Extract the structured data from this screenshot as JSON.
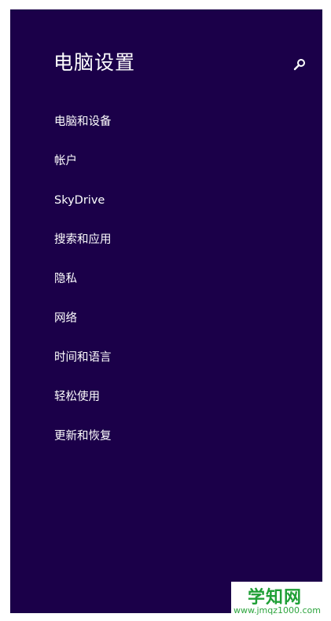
{
  "window": {
    "title": "电脑设置"
  },
  "icons": {
    "search": "search-icon"
  },
  "menu": {
    "items": [
      {
        "label": "电脑和设备"
      },
      {
        "label": "帐户"
      },
      {
        "label": "SkyDrive"
      },
      {
        "label": "搜索和应用"
      },
      {
        "label": "隐私"
      },
      {
        "label": "网络"
      },
      {
        "label": "时间和语言"
      },
      {
        "label": "轻松使用"
      },
      {
        "label": "更新和恢复"
      }
    ]
  },
  "watermark": {
    "site_name": "学知网",
    "url": "www.jmqz1000.com"
  },
  "colors": {
    "panel_background": "#1b0049",
    "text": "#ffffff",
    "watermark_green": "#1f9f36"
  }
}
